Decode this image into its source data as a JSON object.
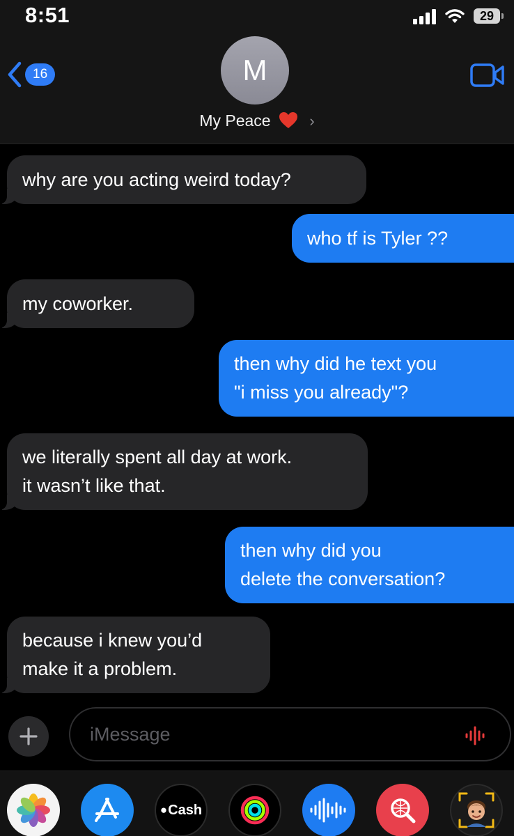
{
  "status_bar": {
    "time": "8:51",
    "battery": "29"
  },
  "header": {
    "back_count": "16",
    "avatar_initial": "M",
    "contact_name": "My Peace"
  },
  "messages": [
    {
      "direction": "incoming",
      "lines": [
        "why are you acting weird today?"
      ]
    },
    {
      "direction": "outgoing",
      "lines": [
        "who tf is Tyler ??"
      ]
    },
    {
      "direction": "incoming",
      "lines": [
        "my coworker."
      ]
    },
    {
      "direction": "outgoing",
      "lines": [
        "then why did he text you",
        "\"i miss you already\"?"
      ]
    },
    {
      "direction": "incoming",
      "lines": [
        "we literally spent all day at work.",
        "it wasn’t like that."
      ]
    },
    {
      "direction": "outgoing",
      "lines": [
        "then why did you",
        "delete the conversation?"
      ]
    },
    {
      "direction": "incoming",
      "lines": [
        "because i knew you’d",
        "make it a problem."
      ]
    }
  ],
  "input": {
    "placeholder": "iMessage"
  },
  "apps": {
    "cash_label": "Cash"
  },
  "colors": {
    "outgoing_bubble": "#1e7cf2",
    "incoming_bubble": "#262628",
    "accent": "#2f7cf6",
    "background": "#000000"
  }
}
